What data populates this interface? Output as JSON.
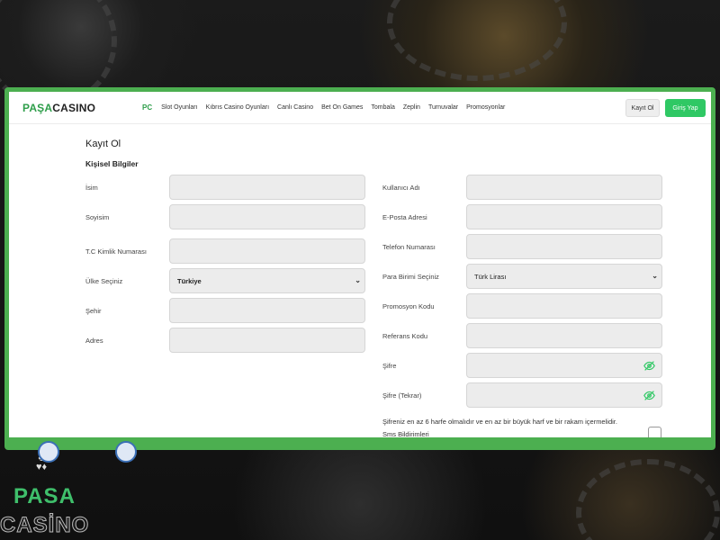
{
  "brand": {
    "part1": "PAŞA",
    "part2": "CASINO"
  },
  "nav": {
    "pc": "PC",
    "items": [
      "Slot Oyunları",
      "Kıbrıs Casino Oyunları",
      "Canlı Casino",
      "Bet On Games",
      "Tombala",
      "Zeplin",
      "Turnuvalar",
      "Promosyonlar"
    ],
    "register": "Kayıt Ol",
    "login": "Giriş Yap"
  },
  "form": {
    "title": "Kayıt Ol",
    "section": "Kişisel Bilgiler",
    "left": {
      "name": "İsim",
      "surname": "Soyisim",
      "tc": "T.C Kimlik Numarası",
      "country": "Ülke Seçiniz",
      "country_value": "Türkiye",
      "city": "Şehir",
      "address": "Adres"
    },
    "right": {
      "username": "Kullanıcı Adı",
      "email": "E-Posta Adresi",
      "phone": "Telefon Numarası",
      "currency": "Para Birimi Seçiniz",
      "currency_value": "Türk Lirası",
      "promo": "Promosyon Kodu",
      "reference": "Referans Kodu",
      "password": "Şifre",
      "password_repeat": "Şifre (Tekrar)"
    },
    "password_note": "Şifreniz en az 6 harfe olmalıdır ve en az bir büyük harf ve bir rakam içermelidir.",
    "sms": "Sms Bildirimleri"
  },
  "background_logo": {
    "line1": "PASA",
    "line2": "CASİNO"
  },
  "colors": {
    "accent": "#2fc864",
    "frame": "#4caf50",
    "brand_green": "#2e9e4a"
  },
  "icons": [
    "eye-off-icon",
    "cards-suit-icon"
  ]
}
